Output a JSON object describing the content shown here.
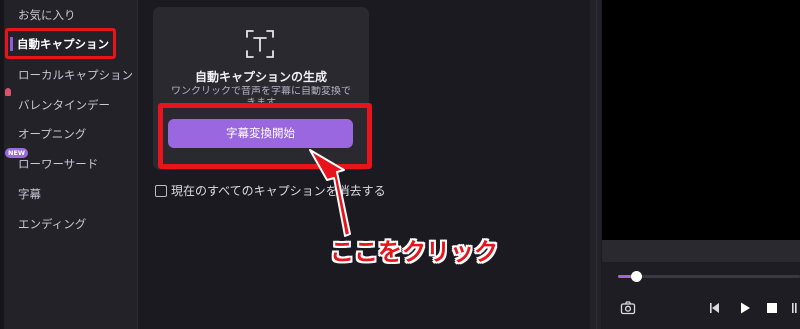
{
  "sidebar": {
    "items": [
      {
        "label": "お気に入り"
      },
      {
        "label": "自動キャプション"
      },
      {
        "label": "ローカルキャプション"
      },
      {
        "label": "バレンタインデー"
      },
      {
        "label": "オープニング"
      },
      {
        "label": "ローワーサード"
      },
      {
        "label": "字幕"
      },
      {
        "label": "エンディング"
      }
    ],
    "new_badge": "NEW"
  },
  "card": {
    "icon": "text-icon",
    "title": "自動キャプションの生成",
    "description": "ワンクリックで音声を字幕に自動変換できます",
    "button_label": "字幕変換開始"
  },
  "clear_option": {
    "label": "現在のすべてのキャプションを消去する",
    "checked": false
  },
  "annotation": {
    "text": "ここをクリック",
    "color": "#e8141c"
  },
  "player": {
    "progress": 0.1,
    "icons": [
      "camera-icon",
      "prev-frame-icon",
      "play-icon",
      "stop-icon",
      "next-icon"
    ]
  },
  "colors": {
    "accent": "#9a67e0",
    "highlight": "#e8141c"
  }
}
